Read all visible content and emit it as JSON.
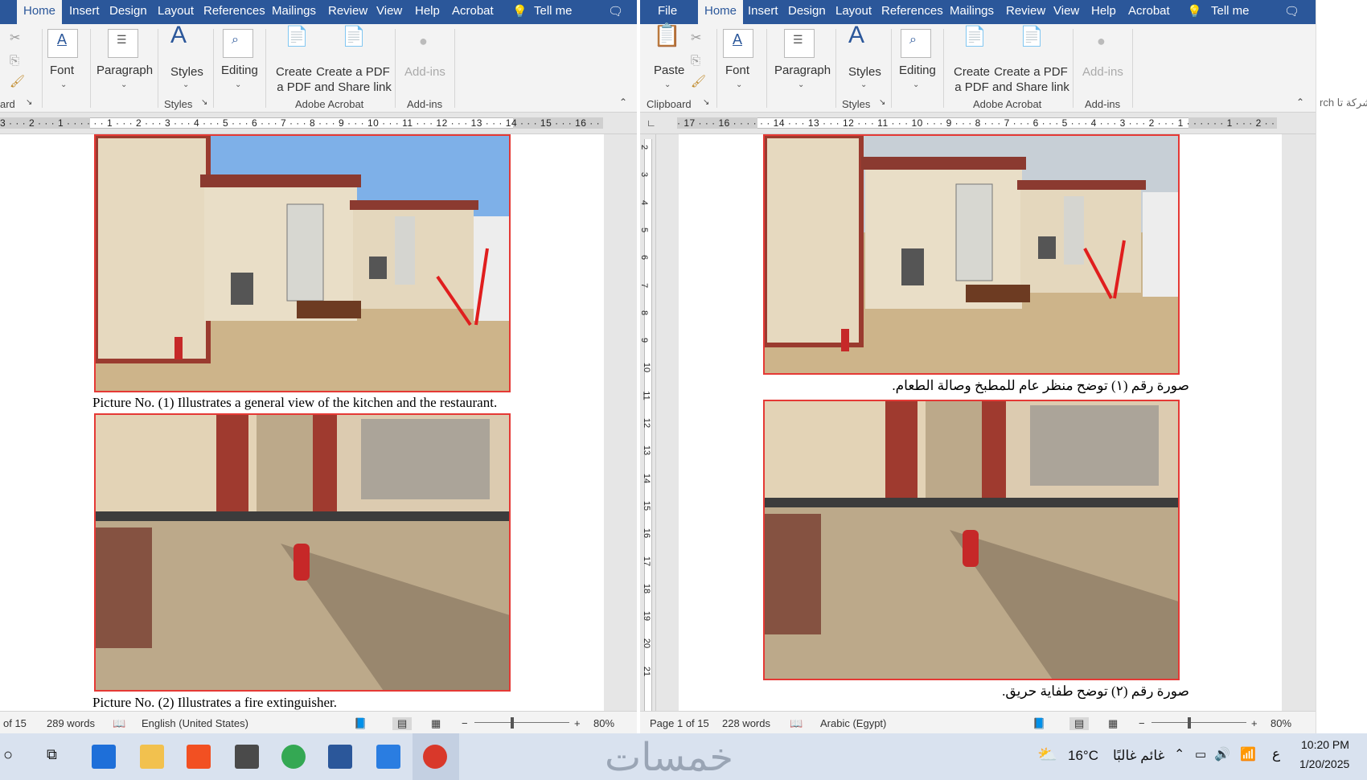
{
  "left_window": {
    "tabs": [
      "Home",
      "Insert",
      "Design",
      "Layout",
      "References",
      "Mailings",
      "Review",
      "View",
      "Help",
      "Acrobat",
      "Tell me"
    ],
    "active_tab": "Home",
    "ribbon": {
      "font": "Font",
      "paragraph": "Paragraph",
      "styles": "Styles",
      "editing": "Editing",
      "create_pdf_1": "Create",
      "create_pdf_2": "a PDF",
      "share_1": "Create a PDF",
      "share_2": "and Share link",
      "addins_btn": "Add-ins",
      "group_clipboard": "ard",
      "group_styles": "Styles",
      "group_acrobat": "Adobe Acrobat",
      "group_addins": "Add-ins"
    },
    "ruler_numbers": "3 · · · 2 · · · 1 · · ·   · · · 1 · · · 2 · · · 3 · · · 4 · · · 5 · · · 6 · · · 7 · · · 8 · · · 9 · · · 10 · · · 11 · · · 12 · · · 13 · · · 14 · · · 15 · · · 16 · · · 17 ·",
    "captions": {
      "picture1": "Picture No. (1) Illustrates a general view of the kitchen and the restaurant.",
      "picture2": "Picture No. (2) Illustrates a fire extinguisher."
    },
    "status": {
      "page": "of 15",
      "words": "289 words",
      "language": "English (United States)",
      "zoom": "80%"
    }
  },
  "right_window": {
    "tabs": [
      "File",
      "Home",
      "Insert",
      "Design",
      "Layout",
      "References",
      "Mailings",
      "Review",
      "View",
      "Help",
      "Acrobat",
      "Tell me"
    ],
    "active_tab": "Home",
    "ribbon": {
      "paste": "Paste",
      "font": "Font",
      "paragraph": "Paragraph",
      "styles": "Styles",
      "editing": "Editing",
      "create_pdf_1": "Create",
      "create_pdf_2": "a PDF",
      "share_1": "Create a PDF",
      "share_2": "and Share link",
      "addins_btn": "Add-ins",
      "group_clipboard": "Clipboard",
      "group_styles": "Styles",
      "group_acrobat": "Adobe Acrobat",
      "group_addins": "Add-ins"
    },
    "ruler_numbers": "· 17 · · · 16 · · ·   · · · 14 · · · 13 · · · 12 · · · 11 · · · 10 · · · 9 · · · 8 · · · 7 · · · 6 · · · 5 · · · 4 · · · 3 · · · 2 · · · 1 · · ·   · · · 1 · · · 2 · · · 3",
    "vruler_numbers": [
      "2",
      "3",
      "4",
      "5",
      "6",
      "7",
      "8",
      "9",
      "10",
      "11",
      "12",
      "13",
      "14",
      "15",
      "16",
      "17",
      "18",
      "19",
      "20",
      "21"
    ],
    "captions": {
      "picture1": "صورة رقم (١) توضح منظر عام للمطبخ وصالة الطعام.",
      "picture2": "صورة رقم (٢) توضح طفاية حريق."
    },
    "status": {
      "page": "Page 1 of 15",
      "words": "228 words",
      "language": "Arabic (Egypt)",
      "zoom": "80%"
    },
    "search_hint": "شركة تا rch"
  },
  "taskbar": {
    "temperature": "16°C",
    "weather": "غائم غالبًا",
    "lang": "ع",
    "time": "10:20 PM",
    "date": "1/20/2025",
    "watermark": "خمسات"
  },
  "colors": {
    "word_blue": "#2b579a",
    "photo_border": "#e53935",
    "taskbar": "#d9e2ef"
  }
}
